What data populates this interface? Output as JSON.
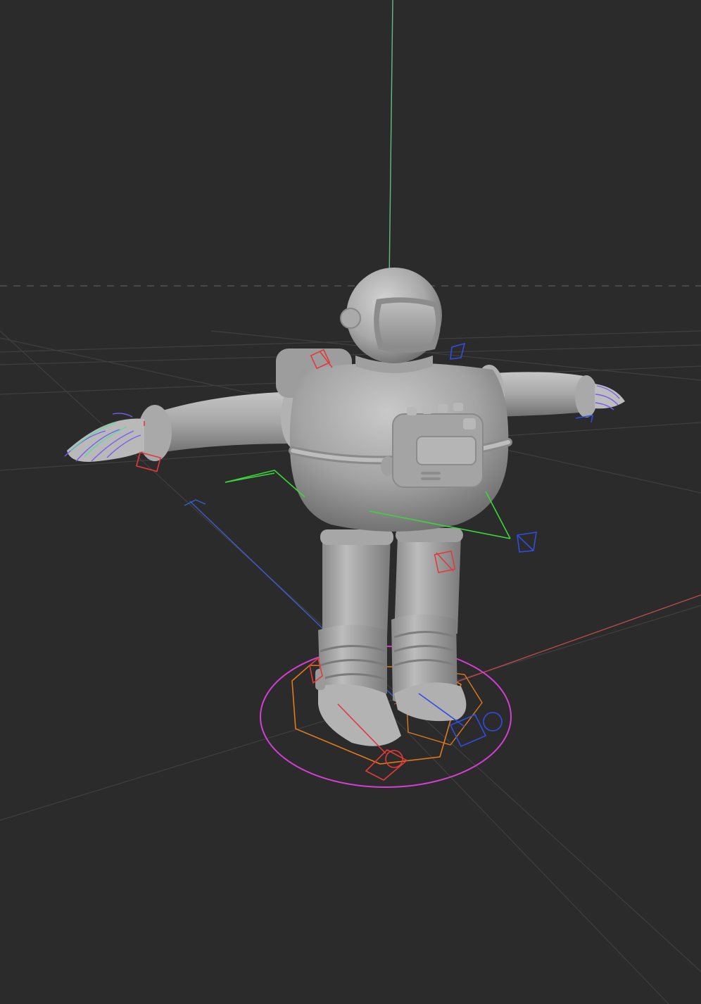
{
  "viewport": {
    "background": "#2b2b2b",
    "grid_color": "#3f3f3f",
    "horizon_color": "#5a5a5a"
  },
  "axes": {
    "y_axis_color": "#5fbf7f",
    "x_axis_color": "#b84a4a",
    "z_axis_color": "#3a5fc8"
  },
  "model": {
    "name": "astronaut-robot",
    "pose": "T-pose",
    "material_color": "#a9a9a9"
  },
  "rig": {
    "root_circle_color": "#d23fd2",
    "ik_foot_color": "#e07a1a",
    "fk_control_color": "#e23a3a",
    "secondary_color": "#2f4ee0",
    "pole_color": "#3ad63a",
    "finger_color": "#7b5cf0"
  }
}
